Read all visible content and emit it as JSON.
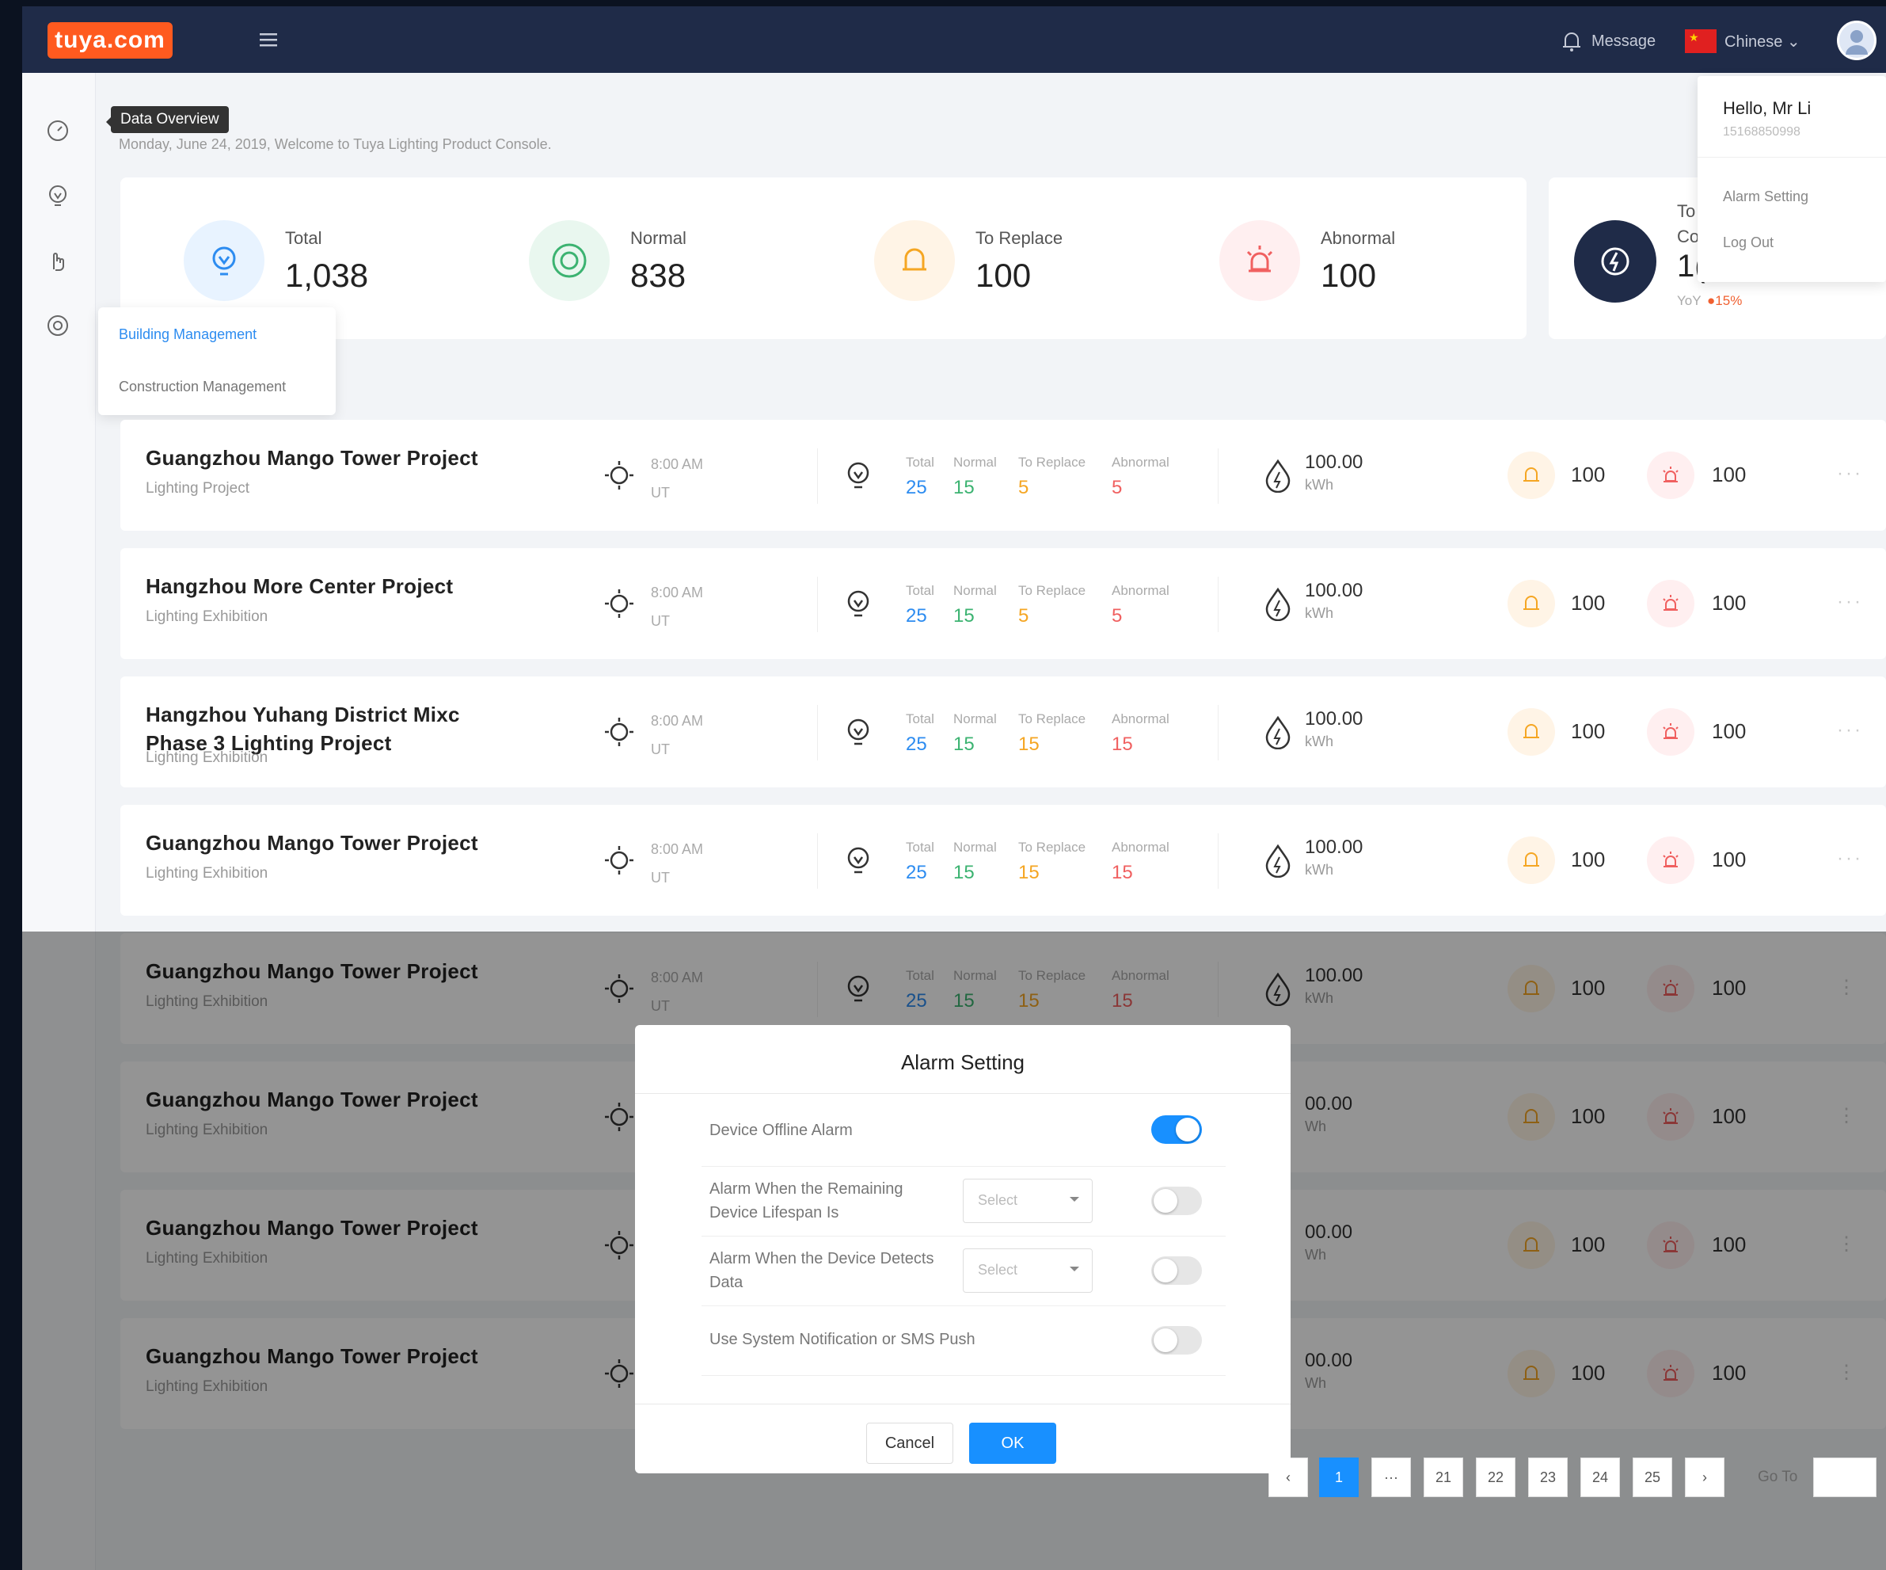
{
  "header": {
    "logo": "tuya.com",
    "message_label": "Message",
    "language_label": "Chinese ⌄"
  },
  "sidebar": {
    "tooltip": "Data Overview"
  },
  "page": {
    "subtitle": "Monday, June 24, 2019, Welcome to Tuya Lighting Product Console."
  },
  "stats": [
    {
      "label": "Total",
      "value": "1,038"
    },
    {
      "label": "Normal",
      "value": "838"
    },
    {
      "label": "To Replace",
      "value": "100"
    },
    {
      "label": "Abnormal",
      "value": "100"
    }
  ],
  "energy": {
    "label1": "To",
    "label2": "Co",
    "value": "1(",
    "yoy_label": "YoY",
    "yoy_value": "15%"
  },
  "user_menu": {
    "greeting": "Hello, Mr Li",
    "phone": "15168850998",
    "alarm_setting": "Alarm Setting",
    "logout": "Log Out"
  },
  "building_menu": {
    "building": "Building Management",
    "construction": "Construction Management"
  },
  "headers": {
    "total": "Total",
    "normal": "Normal",
    "to_replace": "To Replace",
    "abnormal": "Abnormal",
    "kwh_unit": "kWh"
  },
  "projects": [
    {
      "name": "Guangzhou Mango Tower Project",
      "type": "Lighting Project",
      "time": "8:00 AM",
      "tz": "UT",
      "total": "25",
      "normal": "15",
      "replace": "5",
      "abnormal": "5",
      "kwh": "100.00",
      "bell": "100",
      "alarm": "100"
    },
    {
      "name": "Hangzhou More Center Project",
      "type": "Lighting Exhibition",
      "time": "8:00 AM",
      "tz": "UT",
      "total": "25",
      "normal": "15",
      "replace": "5",
      "abnormal": "5",
      "kwh": "100.00",
      "bell": "100",
      "alarm": "100"
    },
    {
      "name": "Hangzhou Yuhang District Mixc Phase 3 Lighting Project",
      "type": "Lighting Exhibition",
      "time": "8:00 AM",
      "tz": "UT",
      "total": "25",
      "normal": "15",
      "replace": "15",
      "abnormal": "15",
      "kwh": "100.00",
      "bell": "100",
      "alarm": "100"
    },
    {
      "name": "Guangzhou Mango Tower Project",
      "type": "Lighting Exhibition",
      "time": "8:00 AM",
      "tz": "UT",
      "total": "25",
      "normal": "15",
      "replace": "15",
      "abnormal": "15",
      "kwh": "100.00",
      "bell": "100",
      "alarm": "100"
    },
    {
      "name": "Guangzhou Mango Tower Project",
      "type": "Lighting Exhibition",
      "time": "8:00 AM",
      "tz": "UT",
      "total": "25",
      "normal": "15",
      "replace": "15",
      "abnormal": "15",
      "kwh": "100.00",
      "bell": "100",
      "alarm": "100"
    },
    {
      "name": "Guangzhou Mango Tower Project",
      "type": "Lighting Exhibition",
      "kwh": "00.00",
      "kwh_unit": "Wh",
      "bell": "100",
      "alarm": "100"
    },
    {
      "name": "Guangzhou Mango Tower Project",
      "type": "Lighting Exhibition",
      "kwh": "00.00",
      "kwh_unit": "Wh",
      "bell": "100",
      "alarm": "100"
    },
    {
      "name": "Guangzhou Mango Tower Project",
      "type": "Lighting Exhibition",
      "kwh": "00.00",
      "kwh_unit": "Wh",
      "bell": "100",
      "alarm": "100"
    }
  ],
  "pagination": {
    "pages": [
      "1",
      "···",
      "21",
      "22",
      "23",
      "24",
      "25"
    ],
    "next": "›",
    "goto": "Go To"
  },
  "modal": {
    "title": "Alarm Setting",
    "offline": "Device Offline Alarm",
    "lifespan": "Alarm When the Remaining Device Lifespan Is",
    "detects": "Alarm When the Device Detects Data",
    "notify": "Use System Notification or SMS Push",
    "select_placeholder": "Select",
    "cancel": "Cancel",
    "ok": "OK"
  },
  "colors": {
    "accent": "#1890ff",
    "topbar": "#1f2b48",
    "normal": "#3cb371",
    "replace": "#f5a623",
    "abnormal": "#f06060",
    "total": "#2d8cf0"
  }
}
